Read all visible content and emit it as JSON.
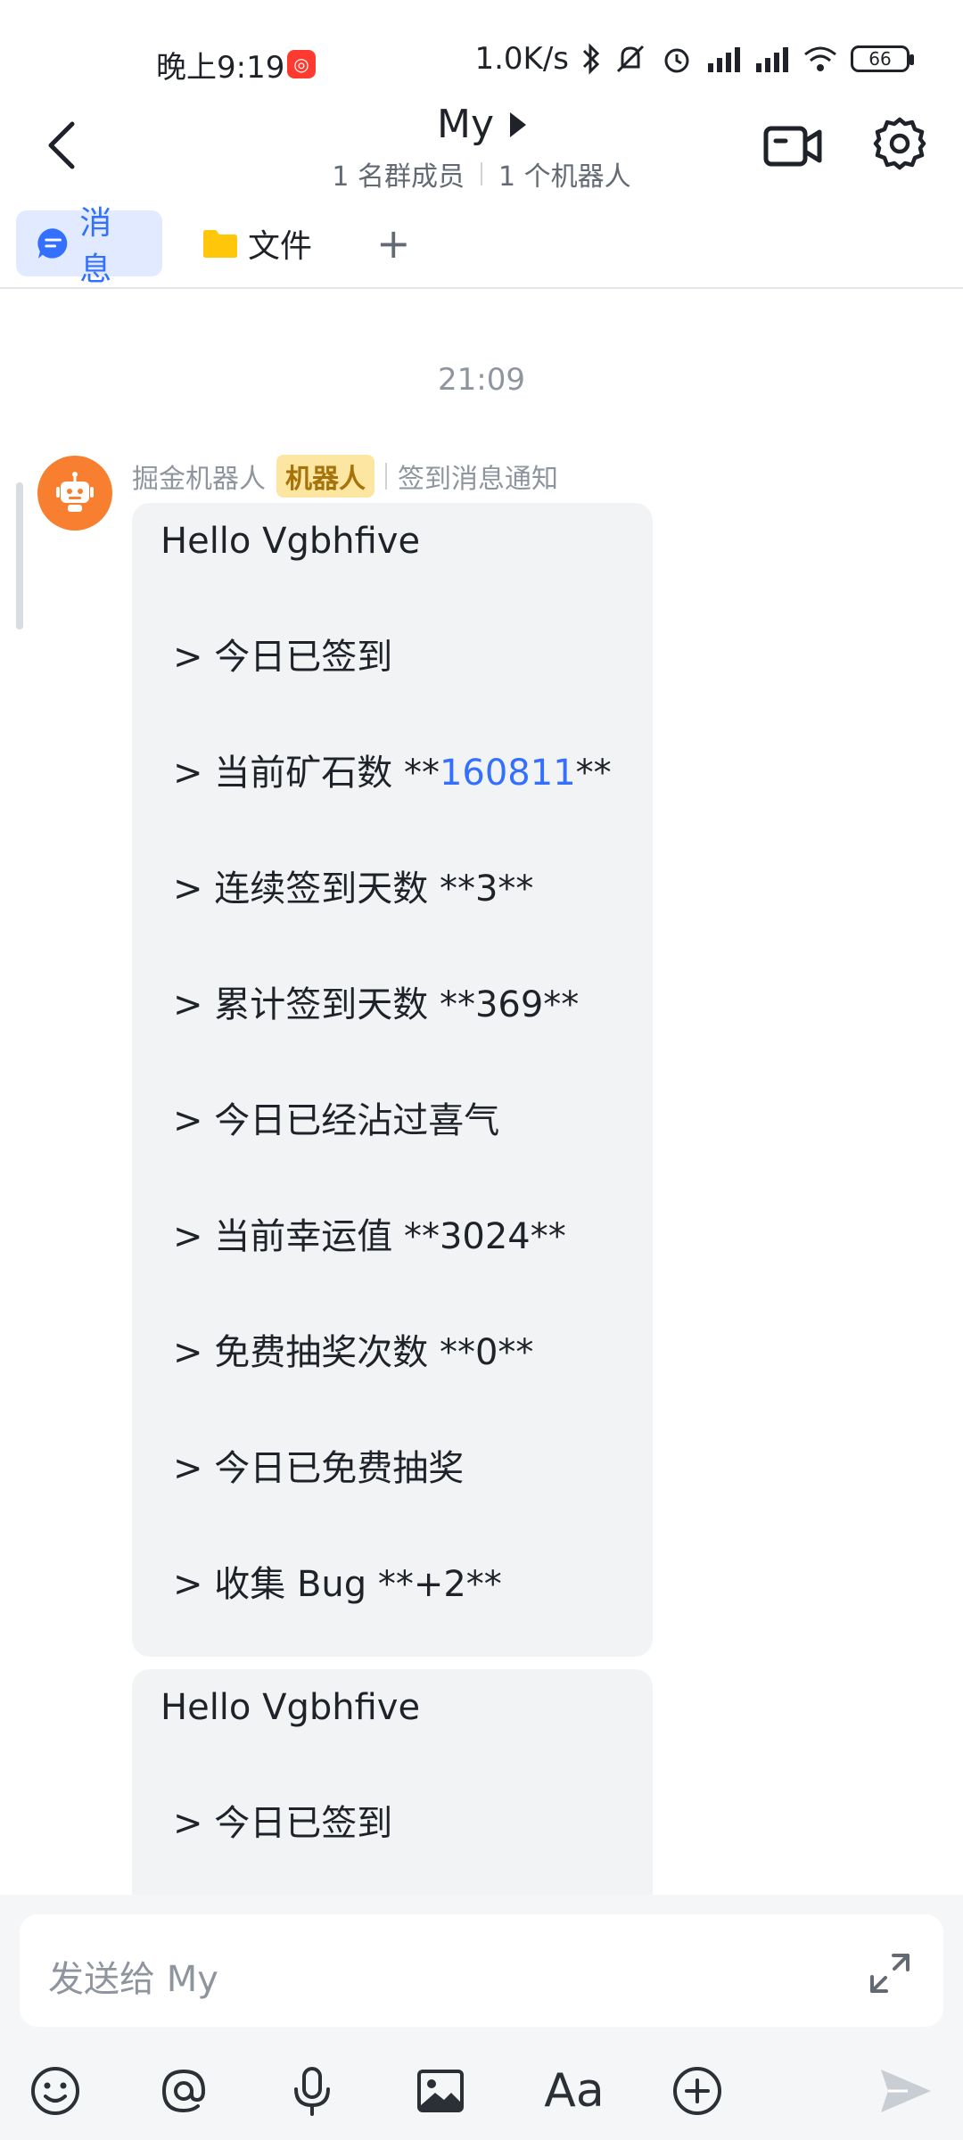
{
  "status_bar": {
    "time": "晚上9:19",
    "notification_glyph": "◎",
    "net_speed": "1.0K/s",
    "battery": "66"
  },
  "header": {
    "title": "My",
    "member_count": "1 名群成员",
    "bot_count": "1 个机器人"
  },
  "tabs": [
    {
      "label": "消息",
      "active": true
    },
    {
      "label": "文件",
      "active": false
    },
    {
      "label": "+",
      "active": false
    }
  ],
  "chat": {
    "timestamp": "21:09",
    "sender": {
      "name": "掘金机器人",
      "badge": "机器人",
      "source": "签到消息通知"
    },
    "messages": [
      {
        "greeting": "Hello Vgbhfive",
        "lines": [
          "> 今日已签到",
          "> 当前矿石数 **",
          "> 连续签到天数 **3**",
          "> 累计签到天数 **369**",
          "> 今日已经沾过喜气",
          "> 当前幸运值 **3024**",
          "> 免费抽奖次数 **0**",
          "> 今日已免费抽奖",
          "> 收集 Bug **+2**"
        ],
        "ore_count_link": "160811",
        "ore_suffix": "**"
      },
      {
        "greeting": "Hello Vgbhfive",
        "lines": [
          "> 今日已签到"
        ]
      }
    ]
  },
  "input": {
    "placeholder": "发送给 My"
  },
  "toolbar": {
    "font_label": "Aa"
  },
  "colors": {
    "accent": "#3370ff",
    "bubble": "#f2f3f5",
    "badge_bg": "#fde6a2",
    "avatar": "#f77f2f"
  }
}
